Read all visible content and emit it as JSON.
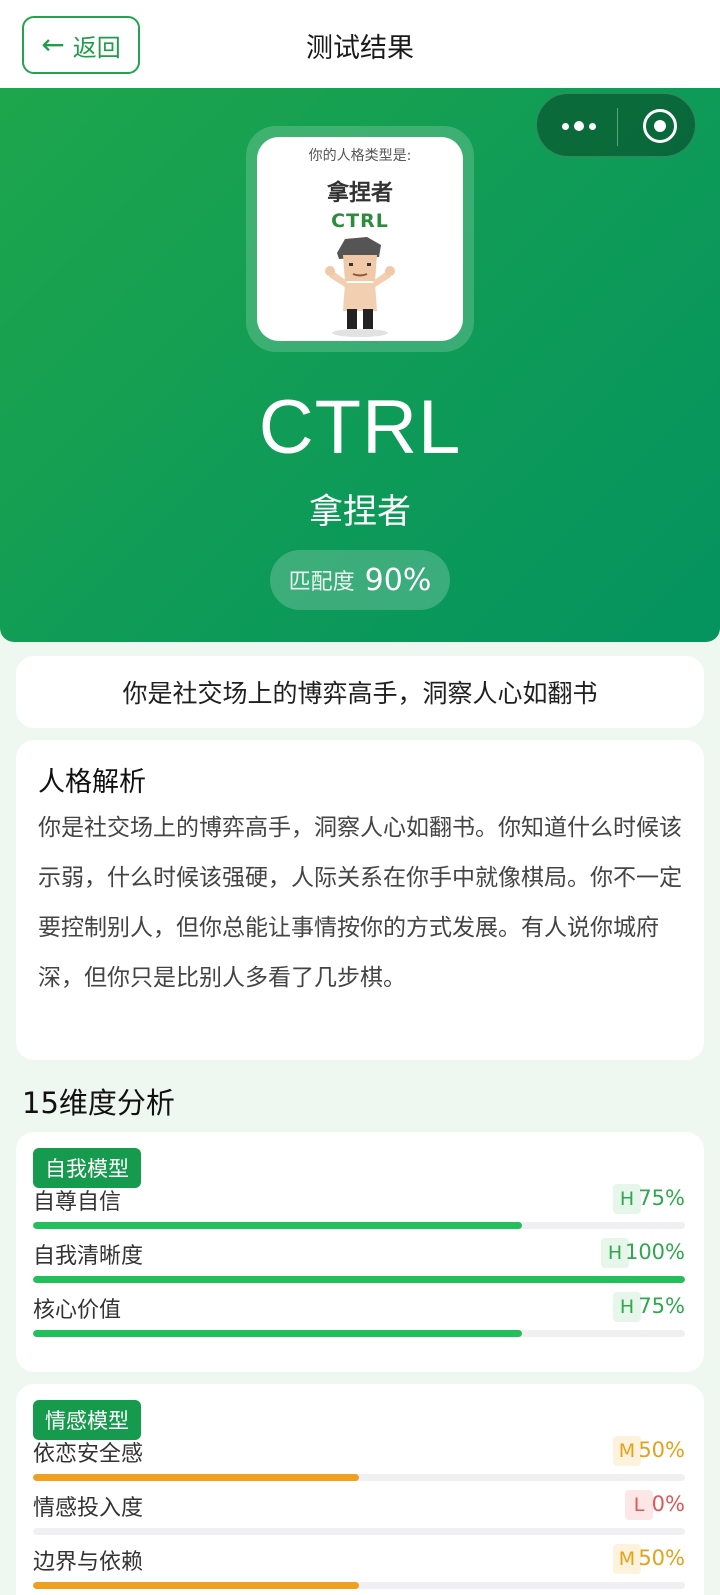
{
  "nav": {
    "back_label": "返回",
    "title": "测试结果"
  },
  "hero": {
    "card_caption": "你的人格类型是:",
    "card_name": "拿捏者",
    "card_code": "CTRL",
    "code": "CTRL",
    "name": "拿捏者",
    "match_label": "匹配度",
    "match_value": "90%"
  },
  "tagline": "你是社交场上的博弈高手，洞察人心如翻书",
  "analysis": {
    "title": "人格解析",
    "body": "你是社交场上的博弈高手，洞察人心如翻书。你知道什么时候该示弱，什么时候该强硬，人际关系在你手中就像棋局。你不一定要控制别人，但你总能让事情按你的方式发展。有人说你城府深，但你只是比别人多看了几步棋。"
  },
  "dimensions_title": "15维度分析",
  "colors": {
    "H": {
      "fg": "#2fa84f",
      "bg": "#e6f6ea",
      "bar": "#22c05a"
    },
    "M": {
      "fg": "#e4a11a",
      "bg": "#fdf2dc",
      "bar": "#efa01f"
    },
    "L": {
      "fg": "#e05656",
      "bg": "#fde6e6",
      "bar": "#e05656"
    }
  },
  "groups": [
    {
      "name": "自我模型",
      "items": [
        {
          "label": "自尊自信",
          "level": "H",
          "value": 75,
          "pct_text": "75%"
        },
        {
          "label": "自我清晰度",
          "level": "H",
          "value": 100,
          "pct_text": "100%"
        },
        {
          "label": "核心价值",
          "level": "H",
          "value": 75,
          "pct_text": "75%"
        }
      ]
    },
    {
      "name": "情感模型",
      "items": [
        {
          "label": "依恋安全感",
          "level": "M",
          "value": 50,
          "pct_text": "50%"
        },
        {
          "label": "情感投入度",
          "level": "L",
          "value": 0,
          "pct_text": "0%"
        },
        {
          "label": "边界与依赖",
          "level": "M",
          "value": 50,
          "pct_text": "50%"
        }
      ]
    }
  ]
}
